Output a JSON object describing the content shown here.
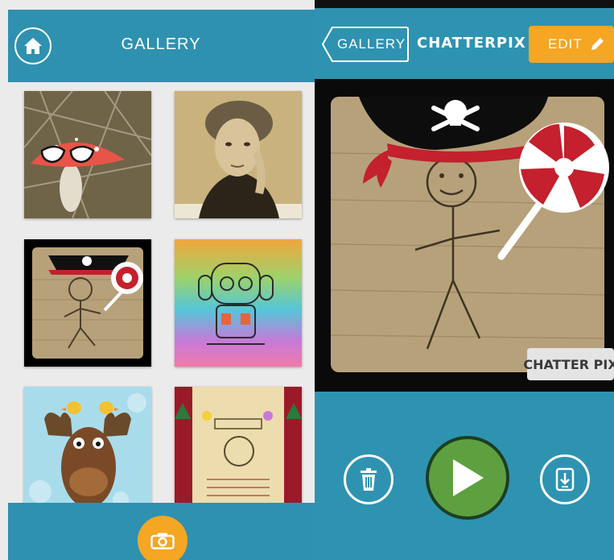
{
  "gallery": {
    "title": "GALLERY",
    "home_icon": "home-icon",
    "camera_icon": "camera-icon",
    "items": [
      {
        "subject": "mushroom with glasses"
      },
      {
        "subject": "sepia portrait of woman"
      },
      {
        "subject": "pirate stick figure"
      },
      {
        "subject": "rainbow cartoon drawing"
      },
      {
        "subject": "moose with ducks"
      },
      {
        "subject": "wanted poster"
      }
    ]
  },
  "editor": {
    "back_label": "GALLERY",
    "app_title": "CHATTERPIX",
    "edit_label": "EDIT",
    "watermark": "CHATTER PIX",
    "trash_icon": "trash-icon",
    "play_icon": "play-icon",
    "share_icon": "share-icon"
  },
  "colors": {
    "header_blue": "#2f91b0",
    "accent_orange": "#f5a623",
    "play_green": "#5ea040",
    "panel_bg": "#ecebeb"
  }
}
